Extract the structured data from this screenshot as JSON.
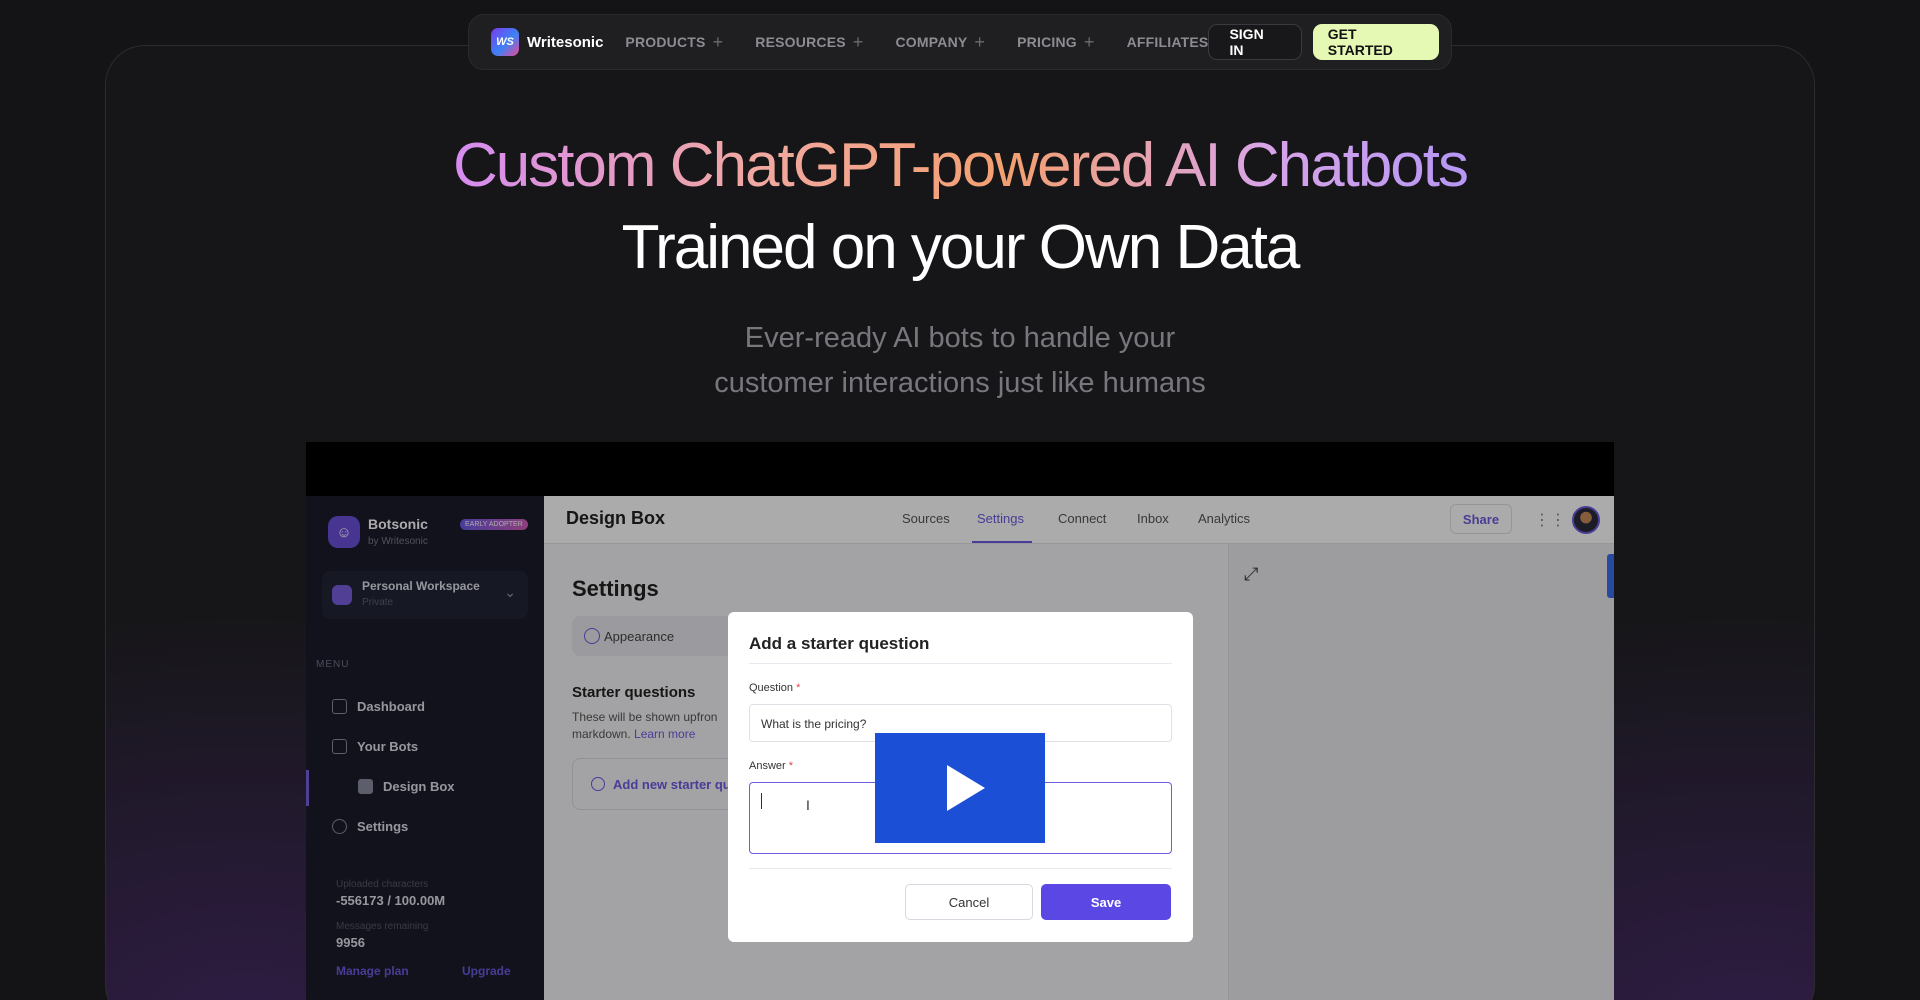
{
  "nav": {
    "logo_mark": "WS",
    "logo_text": "Writesonic",
    "items": [
      {
        "label": "PRODUCTS",
        "plus": "+"
      },
      {
        "label": "RESOURCES",
        "plus": "+"
      },
      {
        "label": "COMPANY",
        "plus": "+"
      },
      {
        "label": "PRICING",
        "plus": "+"
      },
      {
        "label": "AFFILIATES",
        "plus": ""
      }
    ],
    "sign_in": "SIGN IN",
    "get_started": "GET STARTED"
  },
  "hero": {
    "headline": "Custom ChatGPT-powered AI Chatbots",
    "headline2": "Trained on your Own Data",
    "sub1": "Ever-ready AI bots to handle your",
    "sub2": "customer interactions just like humans"
  },
  "app": {
    "sidebar": {
      "brand": "Botsonic",
      "by": "by Writesonic",
      "badge": "EARLY ADOPTER",
      "workspace": "Personal Workspace",
      "workspace_sub": "Private",
      "menu_label": "MENU",
      "items": [
        "Dashboard",
        "Your Bots",
        "Design Box",
        "Settings"
      ],
      "uploaded_label": "Uploaded characters",
      "uploaded_value": "-556173 / 100.00M",
      "messages_label": "Messages remaining",
      "messages_value": "9956",
      "manage_plan": "Manage plan",
      "upgrade": "Upgrade"
    },
    "header": {
      "title": "Design Box",
      "tabs": [
        "Sources",
        "Settings",
        "Connect",
        "Inbox",
        "Analytics"
      ],
      "active_tab": "Settings",
      "share": "Share"
    },
    "settings": {
      "title": "Settings",
      "appearance": "Appearance",
      "starter_title": "Starter questions",
      "starter_desc": "These will be shown upfron",
      "starter_desc2": "markdown.",
      "learn_more": "Learn more",
      "add_new": "Add new starter qu"
    },
    "modal": {
      "title": "Add a starter question",
      "question_label": "Question",
      "question_value": "What is the pricing?",
      "answer_label": "Answer",
      "required_mark": "*",
      "cancel": "Cancel",
      "save": "Save"
    }
  }
}
